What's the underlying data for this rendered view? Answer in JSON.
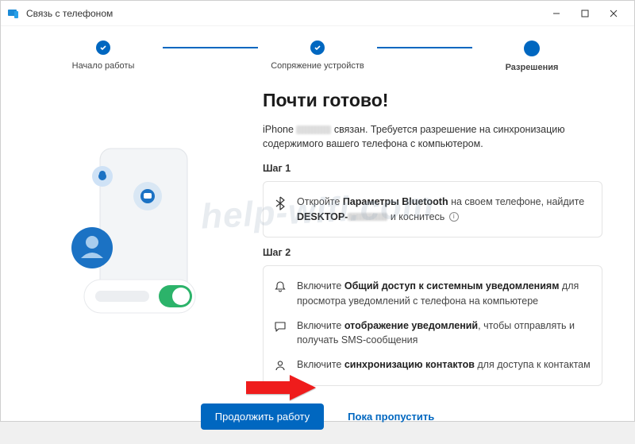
{
  "window": {
    "title": "Связь с телефоном"
  },
  "stepper": {
    "step1": "Начало работы",
    "step2": "Сопряжение устройств",
    "step3": "Разрешения"
  },
  "main": {
    "heading": "Почти готово!",
    "intro_prefix": "iPhone ",
    "intro_suffix": " связан. Требуется разрешение на синхронизацию содержимого вашего телефона с компьютером.",
    "step1_title": "Шаг 1",
    "bt_open": "Откройте ",
    "bt_params": "Параметры Bluetooth",
    "bt_onphone": " на своем телефоне, найдите ",
    "bt_desktop": "DESKTOP-",
    "bt_tap": " и коснитесь ",
    "step2_title": "Шаг 2",
    "r1a": "Включите ",
    "r1b": "Общий доступ к системным уведомлениям",
    "r1c": " для просмотра уведомлений с телефона на компьютере",
    "r2a": "Включите ",
    "r2b": "отображение уведомлений",
    "r2c": ", чтобы отправлять и получать SMS-сообщения",
    "r3a": "Включите ",
    "r3b": "синхронизацию контактов",
    "r3c": " для доступа к контактам"
  },
  "footer": {
    "continue": "Продолжить работу",
    "skip": "Пока пропустить"
  },
  "watermark": "help-wifi.com",
  "colors": {
    "accent": "#0067c0"
  }
}
